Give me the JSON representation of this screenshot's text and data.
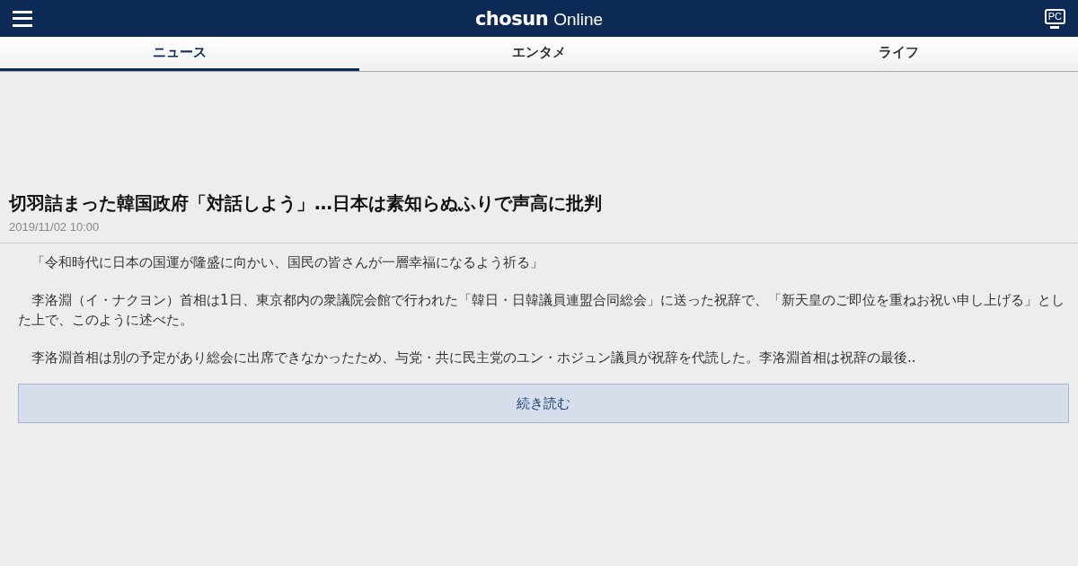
{
  "header": {
    "logo_brand": "chosun",
    "logo_suffix": "Online",
    "pc_link": "PC"
  },
  "tabs": [
    {
      "label": "ニュース",
      "selected": true
    },
    {
      "label": "エンタメ",
      "selected": false
    },
    {
      "label": "ライフ",
      "selected": false
    }
  ],
  "article": {
    "title": "切羽詰まった韓国政府「対話しよう」…日本は素知らぬふりで声高に批判",
    "date": "2019/11/02 10:00",
    "paragraphs": [
      "「令和時代に日本の国運が隆盛に向かい、国民の皆さんが一層幸福になるよう祈る」",
      "李洛淵（イ・ナクヨン）首相は1日、東京都内の衆議院会館で行われた「韓日・日韓議員連盟合同総会」に送った祝辞で、「新天皇のご即位を重ねお祝い申し上げる」とした上で、このように述べた。",
      "李洛淵首相は別の予定があり総会に出席できなかったため、与党・共に民主党のユン・ホジュン議員が祝辞を代読した。李洛淵首相は祝辞の最後.."
    ],
    "read_more": "続き読む"
  }
}
